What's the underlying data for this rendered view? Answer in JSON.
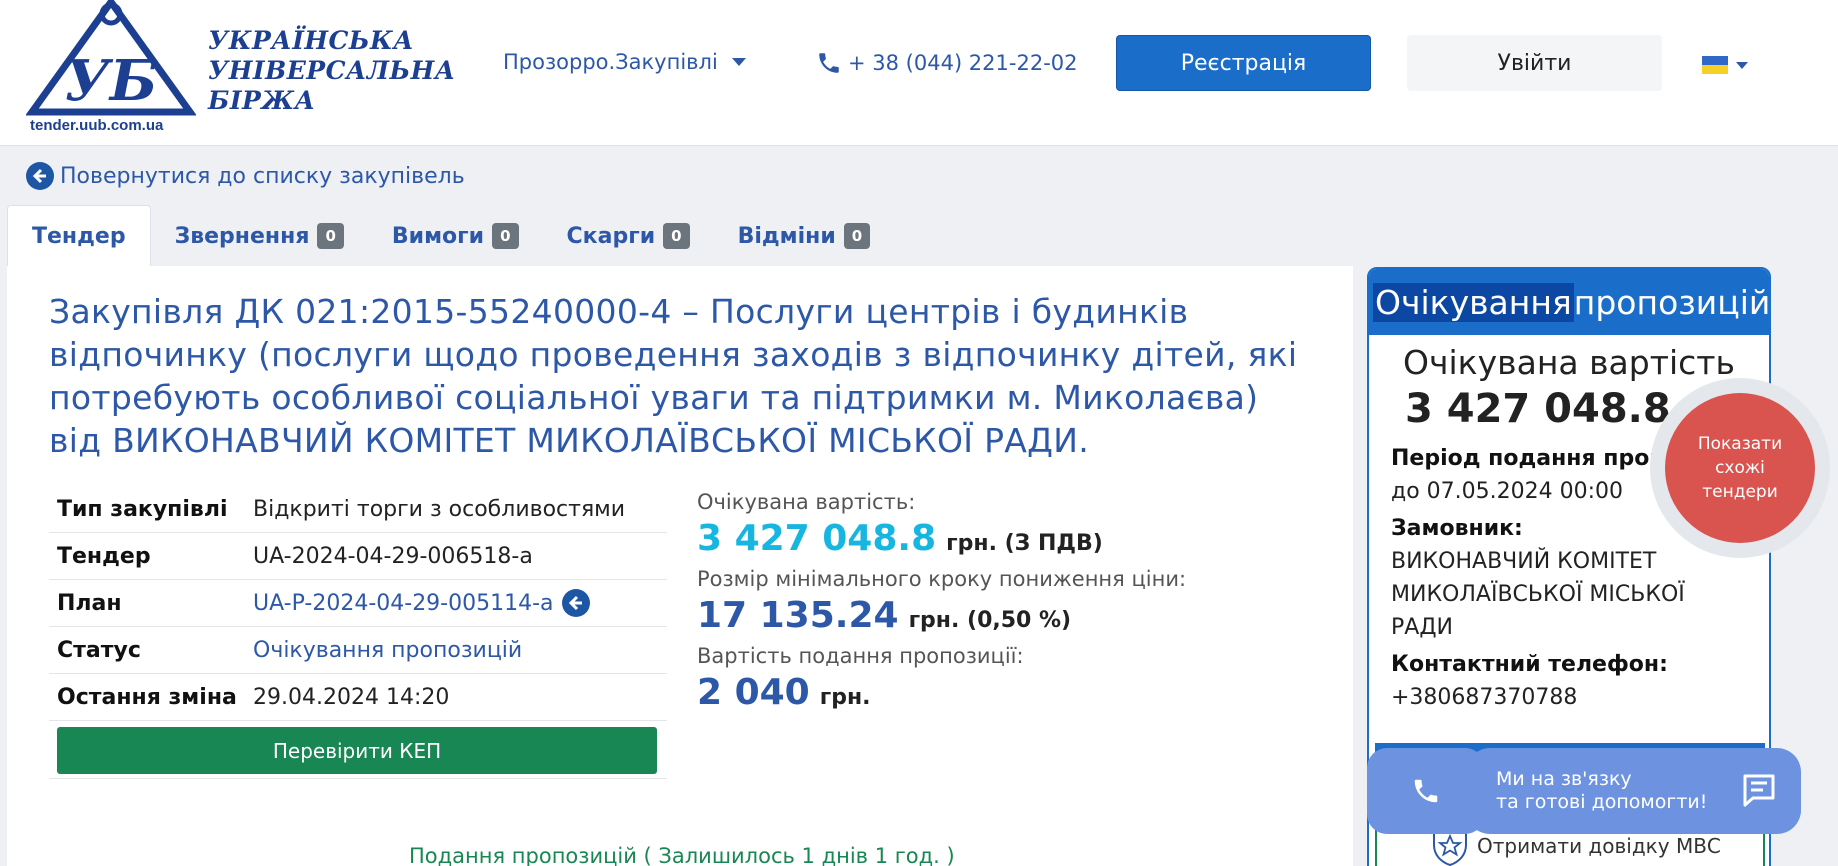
{
  "header": {
    "logo_text_lines": [
      "УКРАЇНСЬКА",
      "УНІВЕРСАЛЬНА",
      "БІРЖА"
    ],
    "logo_mark": "УБ",
    "logo_url": "tender.uub.com.ua",
    "nav_prozorro": "Прозорро.Закупівлі",
    "phone": "+ 38 (044) 221-22-02",
    "register_label": "Реєстрація",
    "login_label": "Увійти",
    "lang_flag": "ua-flag-icon"
  },
  "back_link": "Повернутися до списку закупівель",
  "tabs": [
    {
      "label": "Тендер",
      "count": null
    },
    {
      "label": "Звернення",
      "count": "0"
    },
    {
      "label": "Вимоги",
      "count": "0"
    },
    {
      "label": "Скарги",
      "count": "0"
    },
    {
      "label": "Відміни",
      "count": "0"
    }
  ],
  "tender": {
    "title": "Закупівля ДК 021:2015-55240000-4 – Послуги центрів і будинків відпочинку (послуги щодо проведення заходів з відпочинку дітей, які потребують особливої соціальної уваги та підтримки м. Миколаєва) від ВИКОНАВЧИЙ КОМІТЕТ МИКОЛАЇВСЬКОЇ МІСЬКОЇ РАДИ.",
    "info": [
      {
        "key": "Тип закупівлі",
        "value": "Відкриті торги з особливостями"
      },
      {
        "key": "Тендер",
        "value": "UA-2024-04-29-006518-a"
      },
      {
        "key": "План",
        "value": "UA-P-2024-04-29-005114-a"
      },
      {
        "key": "Статус",
        "value": "Очікування пропозицій"
      },
      {
        "key": "Остання зміна",
        "value": "29.04.2024 14:20"
      }
    ],
    "check_kep_label": "Перевірити КЕП",
    "expected_label": "Очікувана вартість:",
    "expected_value": "3 427 048.8",
    "expected_currency": "грн. (З ПДВ)",
    "min_step_label": "Розмір мінімального кроку пониження ціни:",
    "min_step_value": "17 135.24",
    "min_step_currency": "грн. (0,50 %)",
    "bid_cost_label": "Вартість подання пропозиції:",
    "bid_cost_value": "2 040",
    "bid_cost_currency": "грн.",
    "deadline_text": "Подання пропозицій ( Залишилось 1 днів 1 год. )"
  },
  "side": {
    "status_highlight": "Очікування",
    "status_rest": " пропозицій",
    "expected_title": "Очікувана вартість",
    "expected_amount": "3 427 048.8 грн",
    "period_label": "Період подання пропозицій:",
    "period_value": "до 07.05.2024 00:00",
    "customer_label": "Замовник:",
    "customer_value": "ВИКОНАВЧИЙ КОМІТЕТ МИКОЛАЇВСЬКОЇ МІСЬКОЇ РАДИ",
    "contact_label": "Контактний телефон:",
    "contact_value": "+380687370788",
    "mvs_label": "Отримати довідку МВС"
  },
  "floating": {
    "similar_label": "Показати схожі тендери",
    "chat_line1": "Ми на зв'язку",
    "chat_line2": "та готові допомогти!"
  },
  "colors": {
    "brand_blue": "#1a6dc9",
    "link_blue": "#2d58a8",
    "green": "#198754",
    "cyan": "#17b6e0",
    "red": "#d9534f"
  }
}
